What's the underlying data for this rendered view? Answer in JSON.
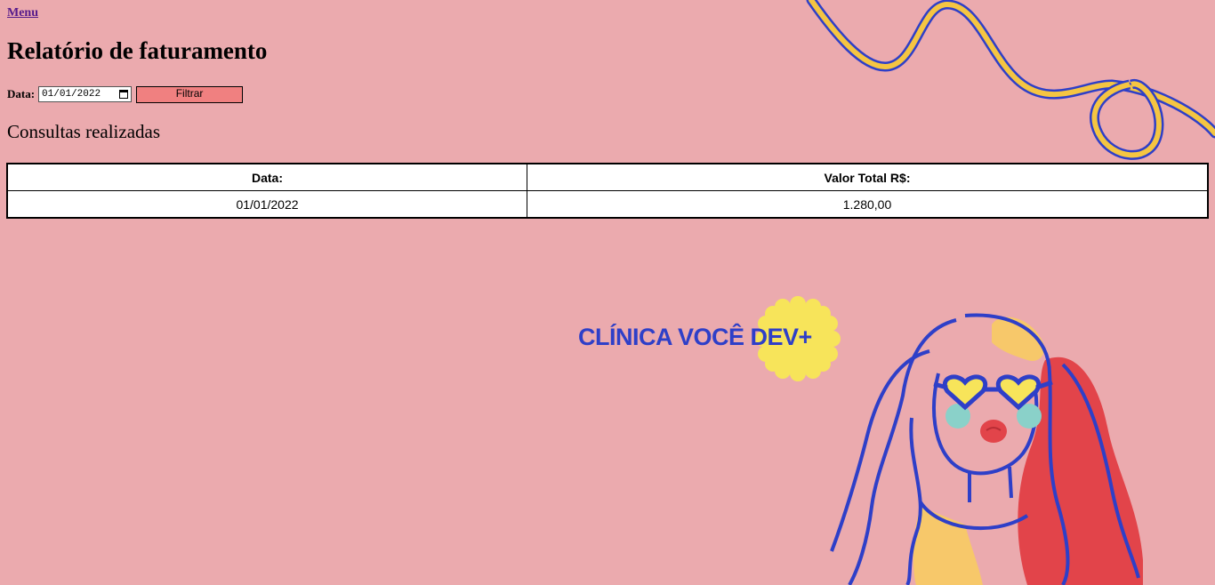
{
  "nav": {
    "menu_label": "Menu"
  },
  "page": {
    "title": "Relatório de faturamento"
  },
  "filter": {
    "label": "Data:",
    "date_value": "01/01/2022",
    "button_label": "Filtrar"
  },
  "section": {
    "title": "Consultas realizadas"
  },
  "table": {
    "headers": [
      "Data:",
      "Valor Total R$:"
    ],
    "rows": [
      [
        "01/01/2022",
        "1.280,00"
      ]
    ]
  },
  "brand": {
    "name": "CLÍNICA VOCÊ DEV+"
  },
  "colors": {
    "background": "#ebaaae",
    "button": "#f08080",
    "brand_blue": "#2e3fc8",
    "accent_yellow": "#f5c542",
    "accent_red": "#e2444a"
  }
}
